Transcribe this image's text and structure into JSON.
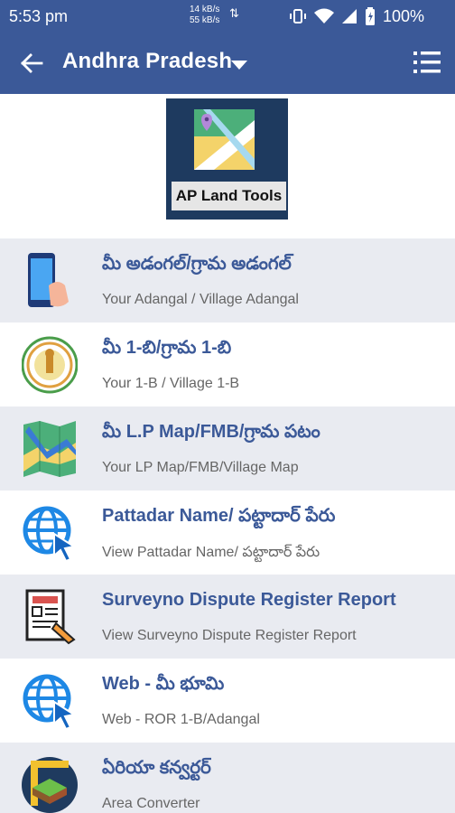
{
  "status_bar": {
    "time": "5:53 pm",
    "net_up": "14 kB/s",
    "net_down": "55 kB/s",
    "battery": "100%"
  },
  "app_bar": {
    "title": "Andhra Pradesh",
    "color": "#3b5998"
  },
  "logo": {
    "label": "AP Land Tools"
  },
  "items": [
    {
      "title": "మీ అడంగల్/గ్రామ అడంగల్",
      "subtitle": "Your Adangal / Village Adangal",
      "icon": "phone-hand-icon"
    },
    {
      "title": "మీ 1-బి/గ్రామ 1-బి",
      "subtitle": "Your 1-B / Village 1-B",
      "icon": "ap-emblem-icon"
    },
    {
      "title": "మీ L.P Map/FMB/గ్రామ పటం",
      "subtitle": "Your LP Map/FMB/Village Map",
      "icon": "folded-map-icon"
    },
    {
      "title": "Pattadar Name/ పట్టాదార్ పేరు",
      "subtitle": "View Pattadar Name/ పట్టాదార్ పేరు",
      "icon": "globe-cursor-icon"
    },
    {
      "title": "Surveyno Dispute Register Report",
      "subtitle": "View Surveyno Dispute Register Report",
      "icon": "document-pen-icon"
    },
    {
      "title": "Web - మీ భూమి",
      "subtitle": "Web - ROR 1-B/Adangal",
      "icon": "globe-cursor-icon"
    },
    {
      "title": "ఏరియా కన్వర్టర్",
      "subtitle": "Area Converter",
      "icon": "area-converter-icon"
    }
  ]
}
